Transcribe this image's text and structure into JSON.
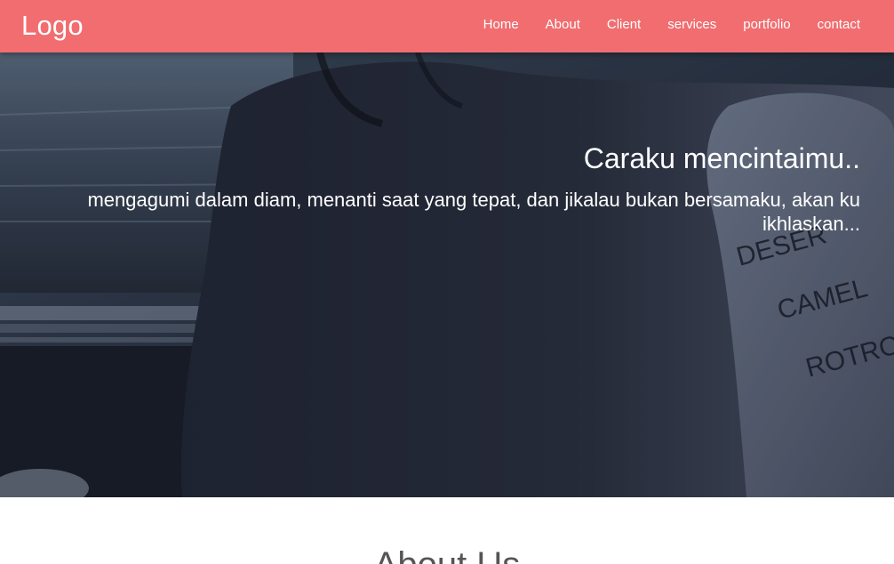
{
  "navbar": {
    "logo": "Logo",
    "links": [
      "Home",
      "About",
      "Client",
      "services",
      "portfolio",
      "contact"
    ],
    "background": "#f16d70"
  },
  "hero": {
    "title": "Caraku mencintaimu..",
    "subtitle": "mengagumi dalam diam, menanti saat yang tepat, dan jikalau bukan bersamaku, akan ku ikhlaskan...",
    "photo_text": [
      "DESER",
      "CAMEL",
      "ROTRO"
    ]
  },
  "about": {
    "title": "About Us"
  }
}
